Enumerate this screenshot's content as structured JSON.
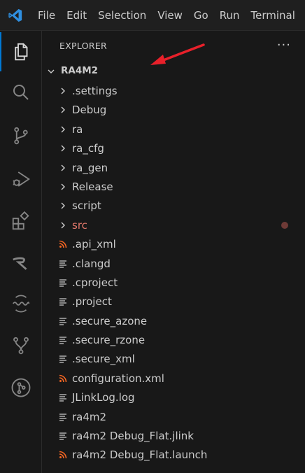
{
  "menu": [
    "File",
    "Edit",
    "Selection",
    "View",
    "Go",
    "Run",
    "Terminal"
  ],
  "activity_icons": [
    "explorer-icon",
    "search-icon",
    "source-control-icon",
    "run-debug-icon",
    "extensions-icon",
    "renesas-icon",
    "serial-monitor-icon",
    "git-graph-icon",
    "git-branch-icon"
  ],
  "explorer": {
    "header": "EXPLORER",
    "more": "···",
    "root": "RA4M2",
    "items": [
      {
        "name": ".settings",
        "type": "folder"
      },
      {
        "name": "Debug",
        "type": "folder"
      },
      {
        "name": "ra",
        "type": "folder"
      },
      {
        "name": "ra_cfg",
        "type": "folder"
      },
      {
        "name": "ra_gen",
        "type": "folder"
      },
      {
        "name": "Release",
        "type": "folder"
      },
      {
        "name": "script",
        "type": "folder"
      },
      {
        "name": "src",
        "type": "folder",
        "modified": true
      },
      {
        "name": ".api_xml",
        "type": "rss"
      },
      {
        "name": ".clangd",
        "type": "lines"
      },
      {
        "name": ".cproject",
        "type": "lines"
      },
      {
        "name": ".project",
        "type": "lines"
      },
      {
        "name": ".secure_azone",
        "type": "lines"
      },
      {
        "name": ".secure_rzone",
        "type": "lines"
      },
      {
        "name": ".secure_xml",
        "type": "lines"
      },
      {
        "name": "configuration.xml",
        "type": "rss"
      },
      {
        "name": "JLinkLog.log",
        "type": "lines"
      },
      {
        "name": "ra4m2",
        "type": "lines"
      },
      {
        "name": "ra4m2 Debug_Flat.jlink",
        "type": "lines"
      },
      {
        "name": "ra4m2 Debug_Flat.launch",
        "type": "rss"
      }
    ]
  },
  "colors": {
    "accent": "#0078d4",
    "arrow": "#e8202a",
    "modified": "#e0776a",
    "rss": "#f26522"
  }
}
